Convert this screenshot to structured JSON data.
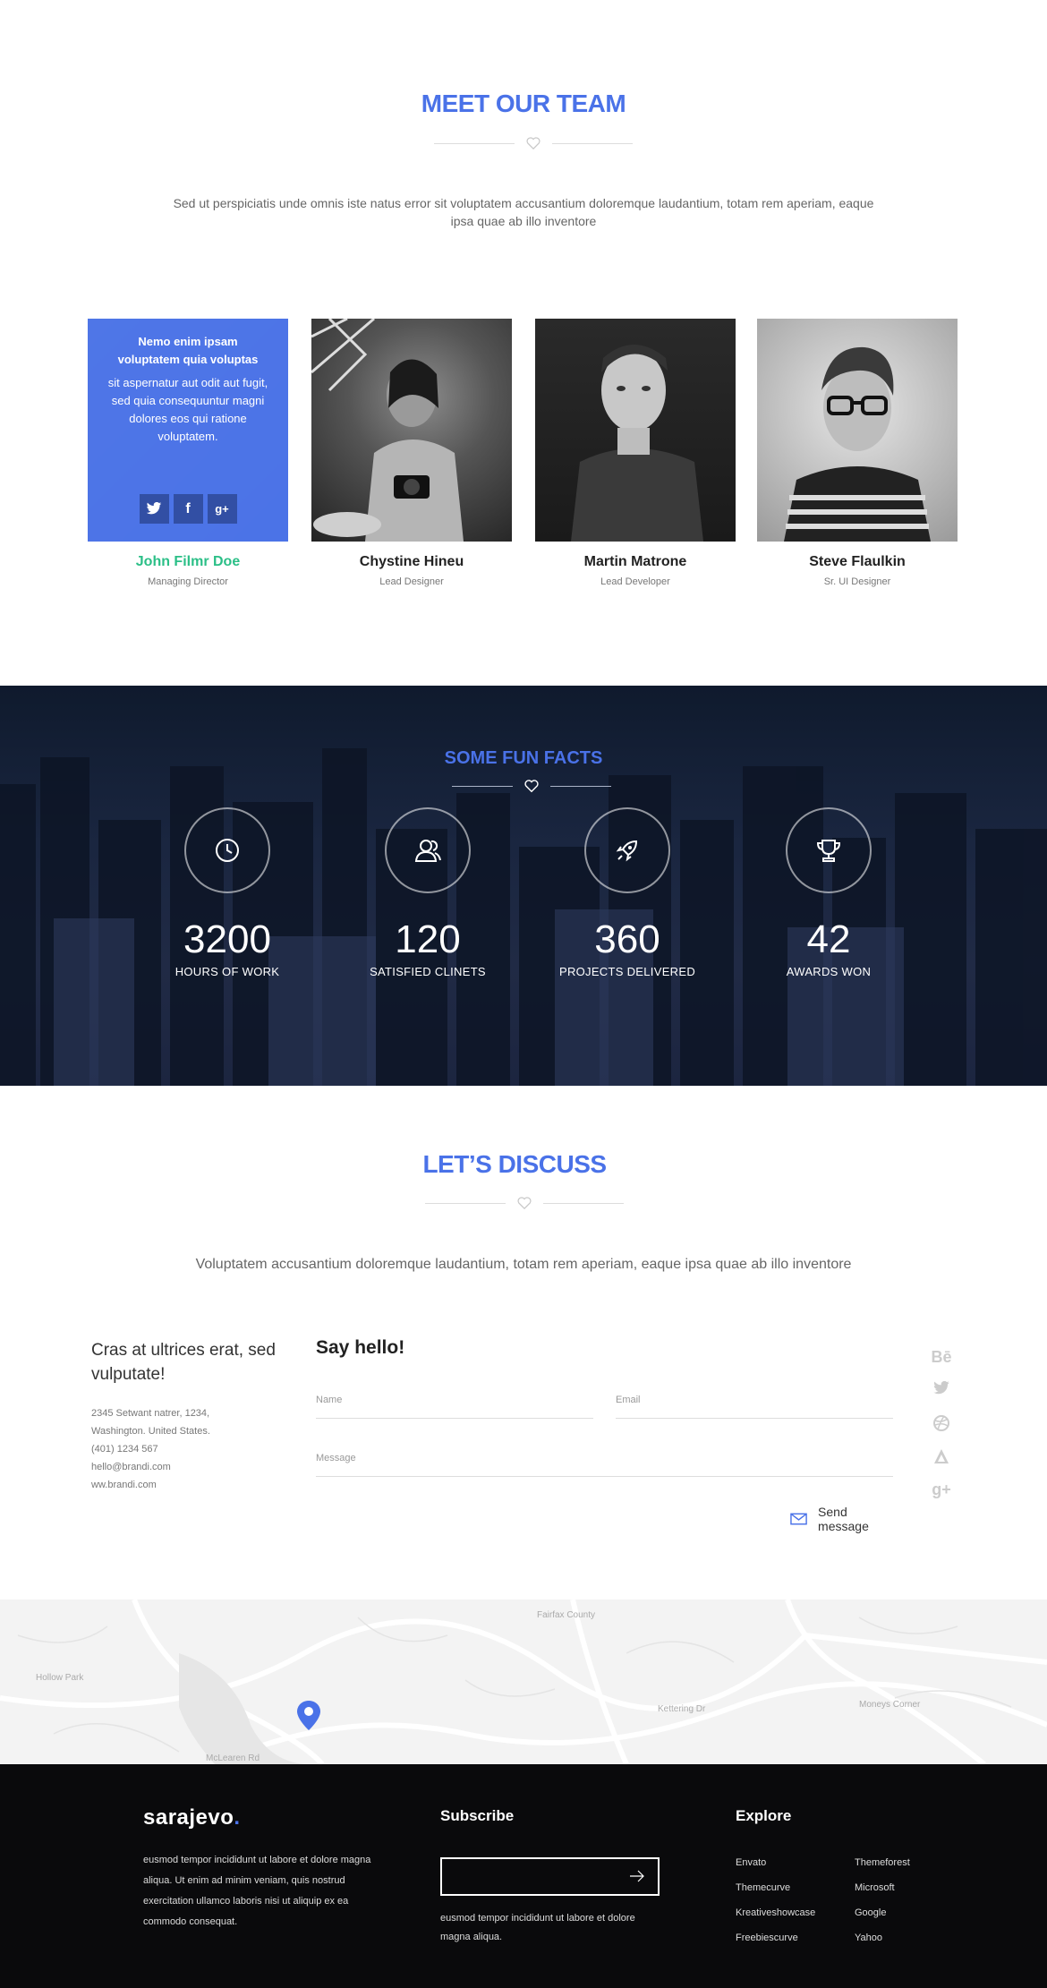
{
  "team": {
    "title": "MEET OUR TEAM",
    "intro": "Sed ut perspiciatis unde omnis iste natus error sit voluptatem accusantium doloremque laudantium, totam rem aperiam, eaque ipsa quae ab illo inventore",
    "overlay": {
      "title": "Nemo enim ipsam voluptatem quia voluptas",
      "text": "sit aspernatur aut odit aut fugit, sed quia consequuntur magni dolores eos qui ratione voluptatem.",
      "socials": [
        "twitter-icon",
        "facebook-icon",
        "google-plus-icon"
      ]
    },
    "members": [
      {
        "name": "John Filmr Doe",
        "role": "Managing Director"
      },
      {
        "name": "Chystine Hineu",
        "role": "Lead Designer"
      },
      {
        "name": "Martin Matrone",
        "role": "Lead Developer"
      },
      {
        "name": "Steve Flaulkin",
        "role": "Sr. UI Designer"
      }
    ]
  },
  "facts": {
    "title": "SOME FUN FACTS",
    "items": [
      {
        "icon": "clock-icon",
        "value": "3200",
        "label": "HOURS OF WORK"
      },
      {
        "icon": "users-icon",
        "value": "120",
        "label": "SATISFIED CLINETS"
      },
      {
        "icon": "rocket-icon",
        "value": "360",
        "label": "PROJECTS DELIVERED"
      },
      {
        "icon": "trophy-icon",
        "value": "42",
        "label": "AWARDS WON"
      }
    ]
  },
  "discuss": {
    "title": "LET’S DISCUSS",
    "intro": "Voluptatem accusantium doloremque laudantium, totam rem aperiam, eaque ipsa quae ab illo inventore",
    "left": {
      "heading": "Cras at ultrices erat, sed vulputate!",
      "address1": "2345 Setwant natrer, 1234,",
      "address2": "Washington. United States.",
      "phone": "(401) 1234 567",
      "email": "hello@brandi.com",
      "web": "ww.brandi.com"
    },
    "form": {
      "heading": "Say hello!",
      "name_placeholder": "Name",
      "email_placeholder": "Email",
      "message_placeholder": "Message",
      "send_label": "Send message"
    },
    "side_socials": [
      "Bē",
      "twitter-icon",
      "dribbble-icon",
      "aa-icon",
      "g+"
    ]
  },
  "map": {
    "labels": [
      "Moneys Corner",
      "Kettering Dr",
      "McLearen Rd",
      "Fairfax County",
      "Hollow Park"
    ]
  },
  "footer": {
    "logo": "sarajevo",
    "logo_dot": ".",
    "about": "eusmod tempor incididunt ut labore et dolore magna aliqua. Ut enim ad minim veniam, quis nostrud exercitation ullamco laboris nisi ut aliquip ex ea commodo consequat.",
    "subscribe_title": "Subscribe",
    "subscribe_text": "eusmod tempor incididunt ut labore et dolore magna aliqua.",
    "explore_title": "Explore",
    "links_col1": [
      "Envato",
      "Themecurve",
      "Kreativeshowcase",
      "Freebiescurve"
    ],
    "links_col2": [
      "Themeforest",
      "Microsoft",
      "Google",
      "Yahoo"
    ]
  },
  "colors": {
    "accent": "#4a72e8",
    "active_name": "#2bbf87",
    "footer_bg": "#0a0a0c"
  }
}
